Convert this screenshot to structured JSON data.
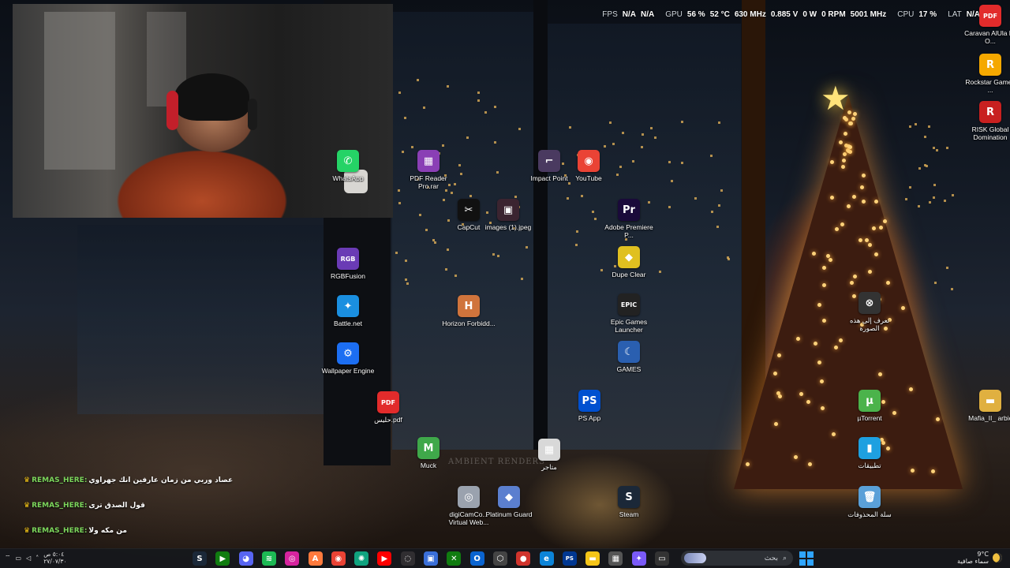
{
  "overlay": {
    "fps_label": "FPS",
    "fps_value1": "N/A",
    "fps_value2": "N/A",
    "gpu_label": "GPU",
    "gpu_load": "56 %",
    "gpu_temp": "52 °C",
    "gpu_clock": "630 MHz",
    "gpu_voltage": "0.885 V",
    "gpu_power": "0 W",
    "gpu_fan": "0 RPM",
    "gpu_mem": "5001 MHz",
    "cpu_label": "CPU",
    "cpu_load": "17 %",
    "lat_label": "LAT",
    "lat_value": "N/A"
  },
  "desktop_icons": [
    {
      "name": "whatsapp",
      "label": "WhatsApp",
      "glyph": "✆",
      "color": "#25d366"
    },
    {
      "name": "rgbfusion",
      "label": "RGBFusion",
      "glyph": "RGB",
      "color": "#6a3bb5"
    },
    {
      "name": "battle-net",
      "label": "Battle.net",
      "glyph": "✦",
      "color": "#1a8fe0"
    },
    {
      "name": "wallpaper-engine",
      "label": "Wallpaper Engine",
      "glyph": "⚙",
      "color": "#1c6ef2"
    },
    {
      "name": "pdf-reader-pro",
      "label": "PDF Reader Pro.rar",
      "glyph": "▦",
      "color": "#8a3fb5"
    },
    {
      "name": "capcut",
      "label": "CapCut",
      "glyph": "✂",
      "color": "#111111"
    },
    {
      "name": "images-jpeg",
      "label": "images (1).jpeg",
      "glyph": "▣",
      "color": "#3b2430"
    },
    {
      "name": "horizon",
      "label": "Horizon Forbidd...",
      "glyph": "H",
      "color": "#d0743c"
    },
    {
      "name": "halees-pdf",
      "label": "حليس.pdf",
      "glyph": "PDF",
      "color": "#e22b2b"
    },
    {
      "name": "muck",
      "label": "Muck",
      "glyph": "M",
      "color": "#3fa84a"
    },
    {
      "name": "digicamcontrol",
      "label": "digiCamCo... Virtual Web...",
      "glyph": "◎",
      "color": "#9aa2ae"
    },
    {
      "name": "platinum-guard",
      "label": "Platinum Guard",
      "glyph": "◆",
      "color": "#5b7fcf"
    },
    {
      "name": "impact-point",
      "label": "Impact Point",
      "glyph": "⌐",
      "color": "#4a3a60"
    },
    {
      "name": "youtube-chrome",
      "label": "YouTube",
      "glyph": "◉",
      "color": "#ea4335"
    },
    {
      "name": "adobe-premiere",
      "label": "Adobe Premiere P...",
      "glyph": "Pr",
      "color": "#1a0a3a"
    },
    {
      "name": "dupe-clear",
      "label": "Dupe Clear",
      "glyph": "◆",
      "color": "#e0c020"
    },
    {
      "name": "epic-games",
      "label": "Epic Games Launcher",
      "glyph": "EPIC",
      "color": "#222222"
    },
    {
      "name": "games-folder",
      "label": "GAMES",
      "glyph": "☾",
      "color": "#2a5fb0"
    },
    {
      "name": "ps-app",
      "label": "PS App",
      "glyph": "PS",
      "color": "#0050d0"
    },
    {
      "name": "store-shortcut",
      "label": "متاجر",
      "glyph": "▦",
      "color": "#d8d8d8"
    },
    {
      "name": "steam",
      "label": "Steam",
      "glyph": "S",
      "color": "#1b2838"
    },
    {
      "name": "learn-image",
      "label": "تعرف إلى هذه الصورة",
      "glyph": "⊗",
      "color": "#333333"
    },
    {
      "name": "utorrent",
      "label": "µTorrent",
      "glyph": "µ",
      "color": "#4bb34b"
    },
    {
      "name": "apps-folder",
      "label": "تطبيقات",
      "glyph": "▮",
      "color": "#1ea0e0"
    },
    {
      "name": "recycle-bin",
      "label": "سلة المحذوفات",
      "glyph": "🗑",
      "color": "#5aa0d8"
    },
    {
      "name": "caravan",
      "label": "Caravan AlUla by O...",
      "glyph": "PDF",
      "color": "#e22b2b"
    },
    {
      "name": "rockstar",
      "label": "Rockstar Games ...",
      "glyph": "R",
      "color": "#f5a800"
    },
    {
      "name": "risk",
      "label": "RISK Global Domination",
      "glyph": "R",
      "color": "#c82020"
    },
    {
      "name": "mafia-arabic",
      "label": "Mafia_II_ arbic",
      "glyph": "▬",
      "color": "#e0b040"
    }
  ],
  "chat": [
    {
      "user": "REMAS_HERE:",
      "message": "عصاد وربي من زمان عارفين انك جهراوي"
    },
    {
      "user": "REMAS_HERE:",
      "message": "قول الصدق ترى"
    },
    {
      "user": "REMAS_HERE:",
      "message": "من مكه ولا"
    }
  ],
  "taskbar": {
    "clock_time": "٥:٠٤ ص",
    "clock_date": "٢٧/٠٧/٣٠",
    "search_placeholder": "بحث",
    "weather_temp": "9°C",
    "weather_desc": "سماء صافية",
    "apps": [
      "steam",
      "game-pass",
      "discord",
      "spotify",
      "instagram",
      "arc",
      "chrome",
      "chatgpt",
      "youtube",
      "obs",
      "movies",
      "xbox",
      "outlook",
      "cube",
      "red-app",
      "edge",
      "playstation",
      "file-explorer",
      "calculator",
      "copilot",
      "terminal"
    ]
  },
  "watermark": "AMBIENT RENDERS"
}
